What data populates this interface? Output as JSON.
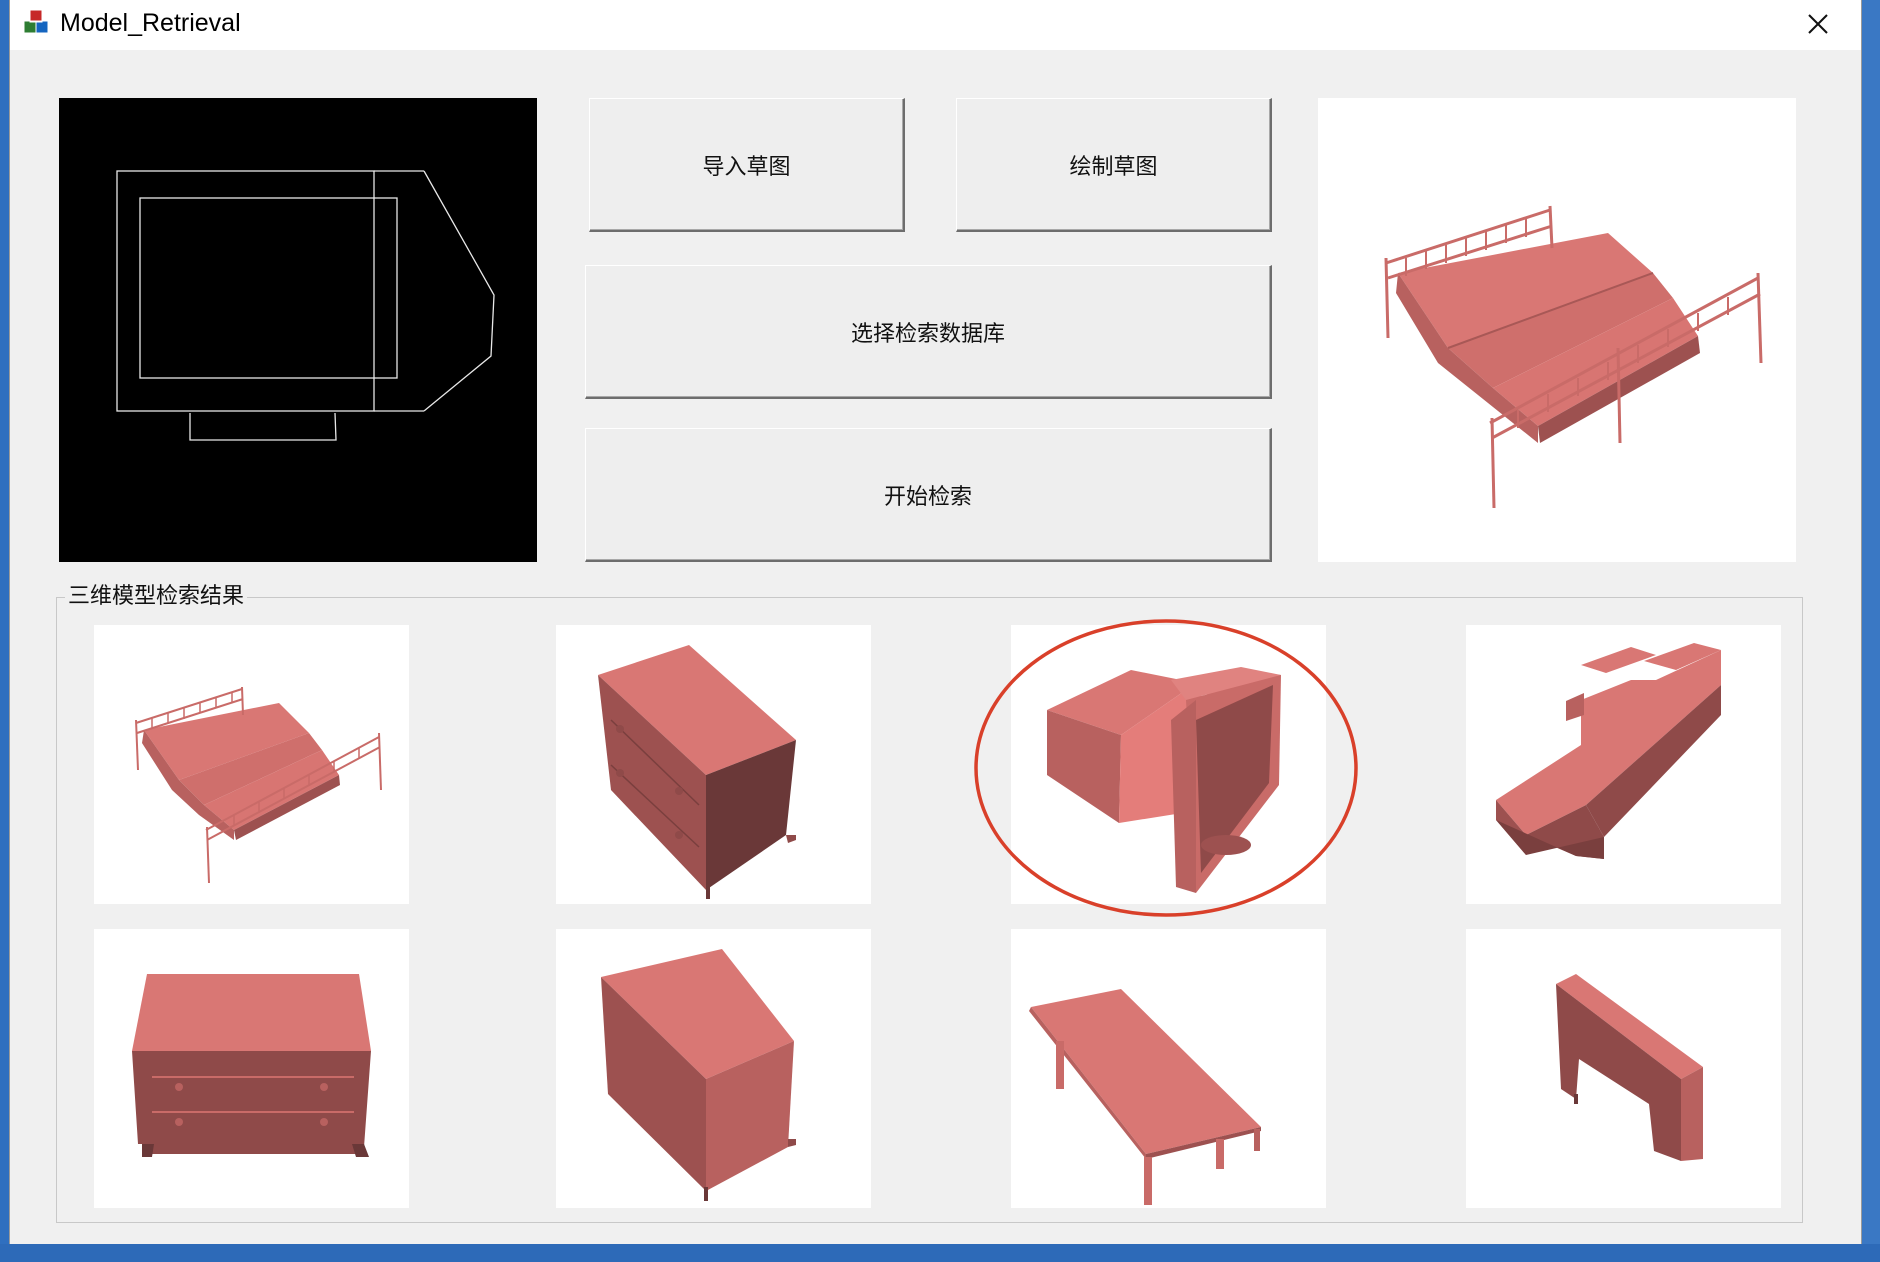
{
  "window": {
    "title": "Model_Retrieval",
    "app_icon": "app-cubes-icon",
    "close_icon": "close-icon"
  },
  "toolbar": {
    "import_sketch_label": "导入草图",
    "draw_sketch_label": "绘制草图",
    "select_database_label": "选择检索数据库",
    "start_retrieval_label": "开始检索"
  },
  "sketch_canvas": {
    "content": "monitor-sketch",
    "background": "#000000",
    "stroke": "#ffffff"
  },
  "preview": {
    "model": "bed"
  },
  "results": {
    "group_label": "三维模型检索结果",
    "items": [
      {
        "model": "bed",
        "highlighted": false
      },
      {
        "model": "nightstand",
        "highlighted": false
      },
      {
        "model": "monitor",
        "highlighted": true
      },
      {
        "model": "sofa",
        "highlighted": false
      },
      {
        "model": "dresser",
        "highlighted": false
      },
      {
        "model": "cabinet",
        "highlighted": false
      },
      {
        "model": "table",
        "highlighted": false
      },
      {
        "model": "desk",
        "highlighted": false
      }
    ]
  },
  "colors": {
    "model_light": "#d97774",
    "model_mid": "#b8615f",
    "model_dark": "#8f4a49",
    "model_shadow": "#6a3838",
    "highlight_ring": "#d9402a"
  }
}
